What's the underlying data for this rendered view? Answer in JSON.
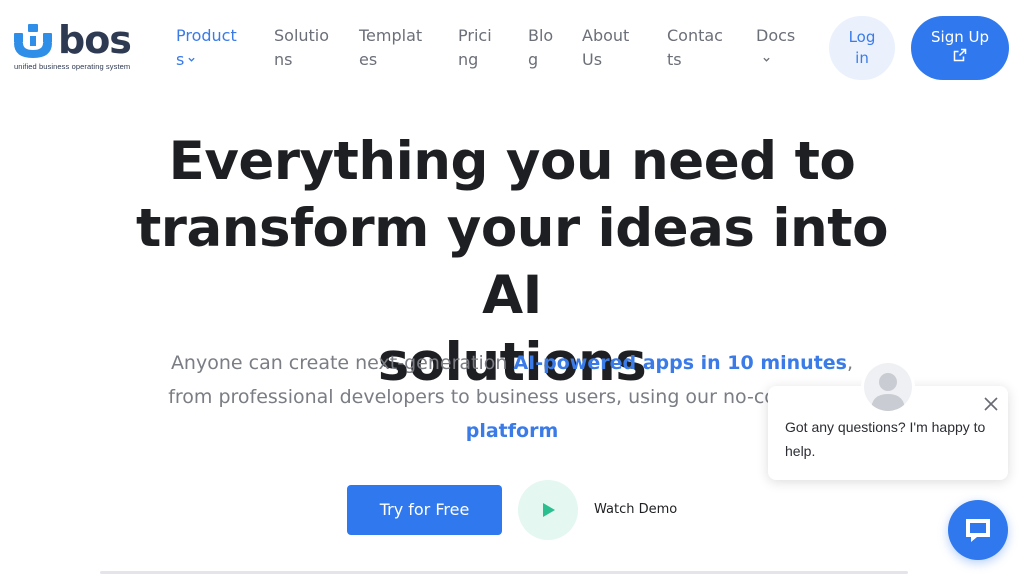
{
  "brand": {
    "name": "bos",
    "tagline": "unified business operating system",
    "accent": "#2f78ee",
    "link_color": "#3a7be8",
    "logo_mark_color": "#2f8fe8"
  },
  "nav": {
    "items": [
      {
        "line1": "Product",
        "line2": "s",
        "has_dropdown": true,
        "active": true
      },
      {
        "line1": "Solutio",
        "line2": "ns",
        "has_dropdown": false,
        "active": false
      },
      {
        "line1": "Templat",
        "line2": "es",
        "has_dropdown": false,
        "active": false
      },
      {
        "line1": "Prici",
        "line2": "ng",
        "has_dropdown": false,
        "active": false
      },
      {
        "line1": "Blo",
        "line2": "g",
        "has_dropdown": false,
        "active": false
      },
      {
        "line1": "About",
        "line2": "Us",
        "has_dropdown": false,
        "active": false
      },
      {
        "line1": "Contac",
        "line2": "ts",
        "has_dropdown": false,
        "active": false
      },
      {
        "line1": "Docs",
        "line2": "",
        "has_dropdown": true,
        "active": false
      }
    ],
    "login": {
      "line1": "Log",
      "line2": "in"
    },
    "signup": {
      "label": "Sign Up",
      "icon": "external-link-icon"
    }
  },
  "hero": {
    "title_lines": [
      "Everything you need to",
      "transform your ideas into AI",
      "solutions"
    ],
    "subtitle": {
      "part1": "Anyone can create next-generation ",
      "highlight1": "AI-powered apps in 10 minutes",
      "part2": ",",
      "part3": "from professional developers to business users, using our no-code/low-c",
      "highlight2": "platform"
    },
    "cta_primary": "Try for Free",
    "cta_secondary": "Watch Demo",
    "play_icon": "play-icon",
    "play_bg": "#e4f7f1",
    "play_color": "#2bbf8f"
  },
  "chat": {
    "message": "Got any questions? I'm happy to help.",
    "close_icon": "close-icon",
    "avatar_icon": "user-avatar-icon",
    "launcher_icon": "chat-bubble-icon"
  }
}
